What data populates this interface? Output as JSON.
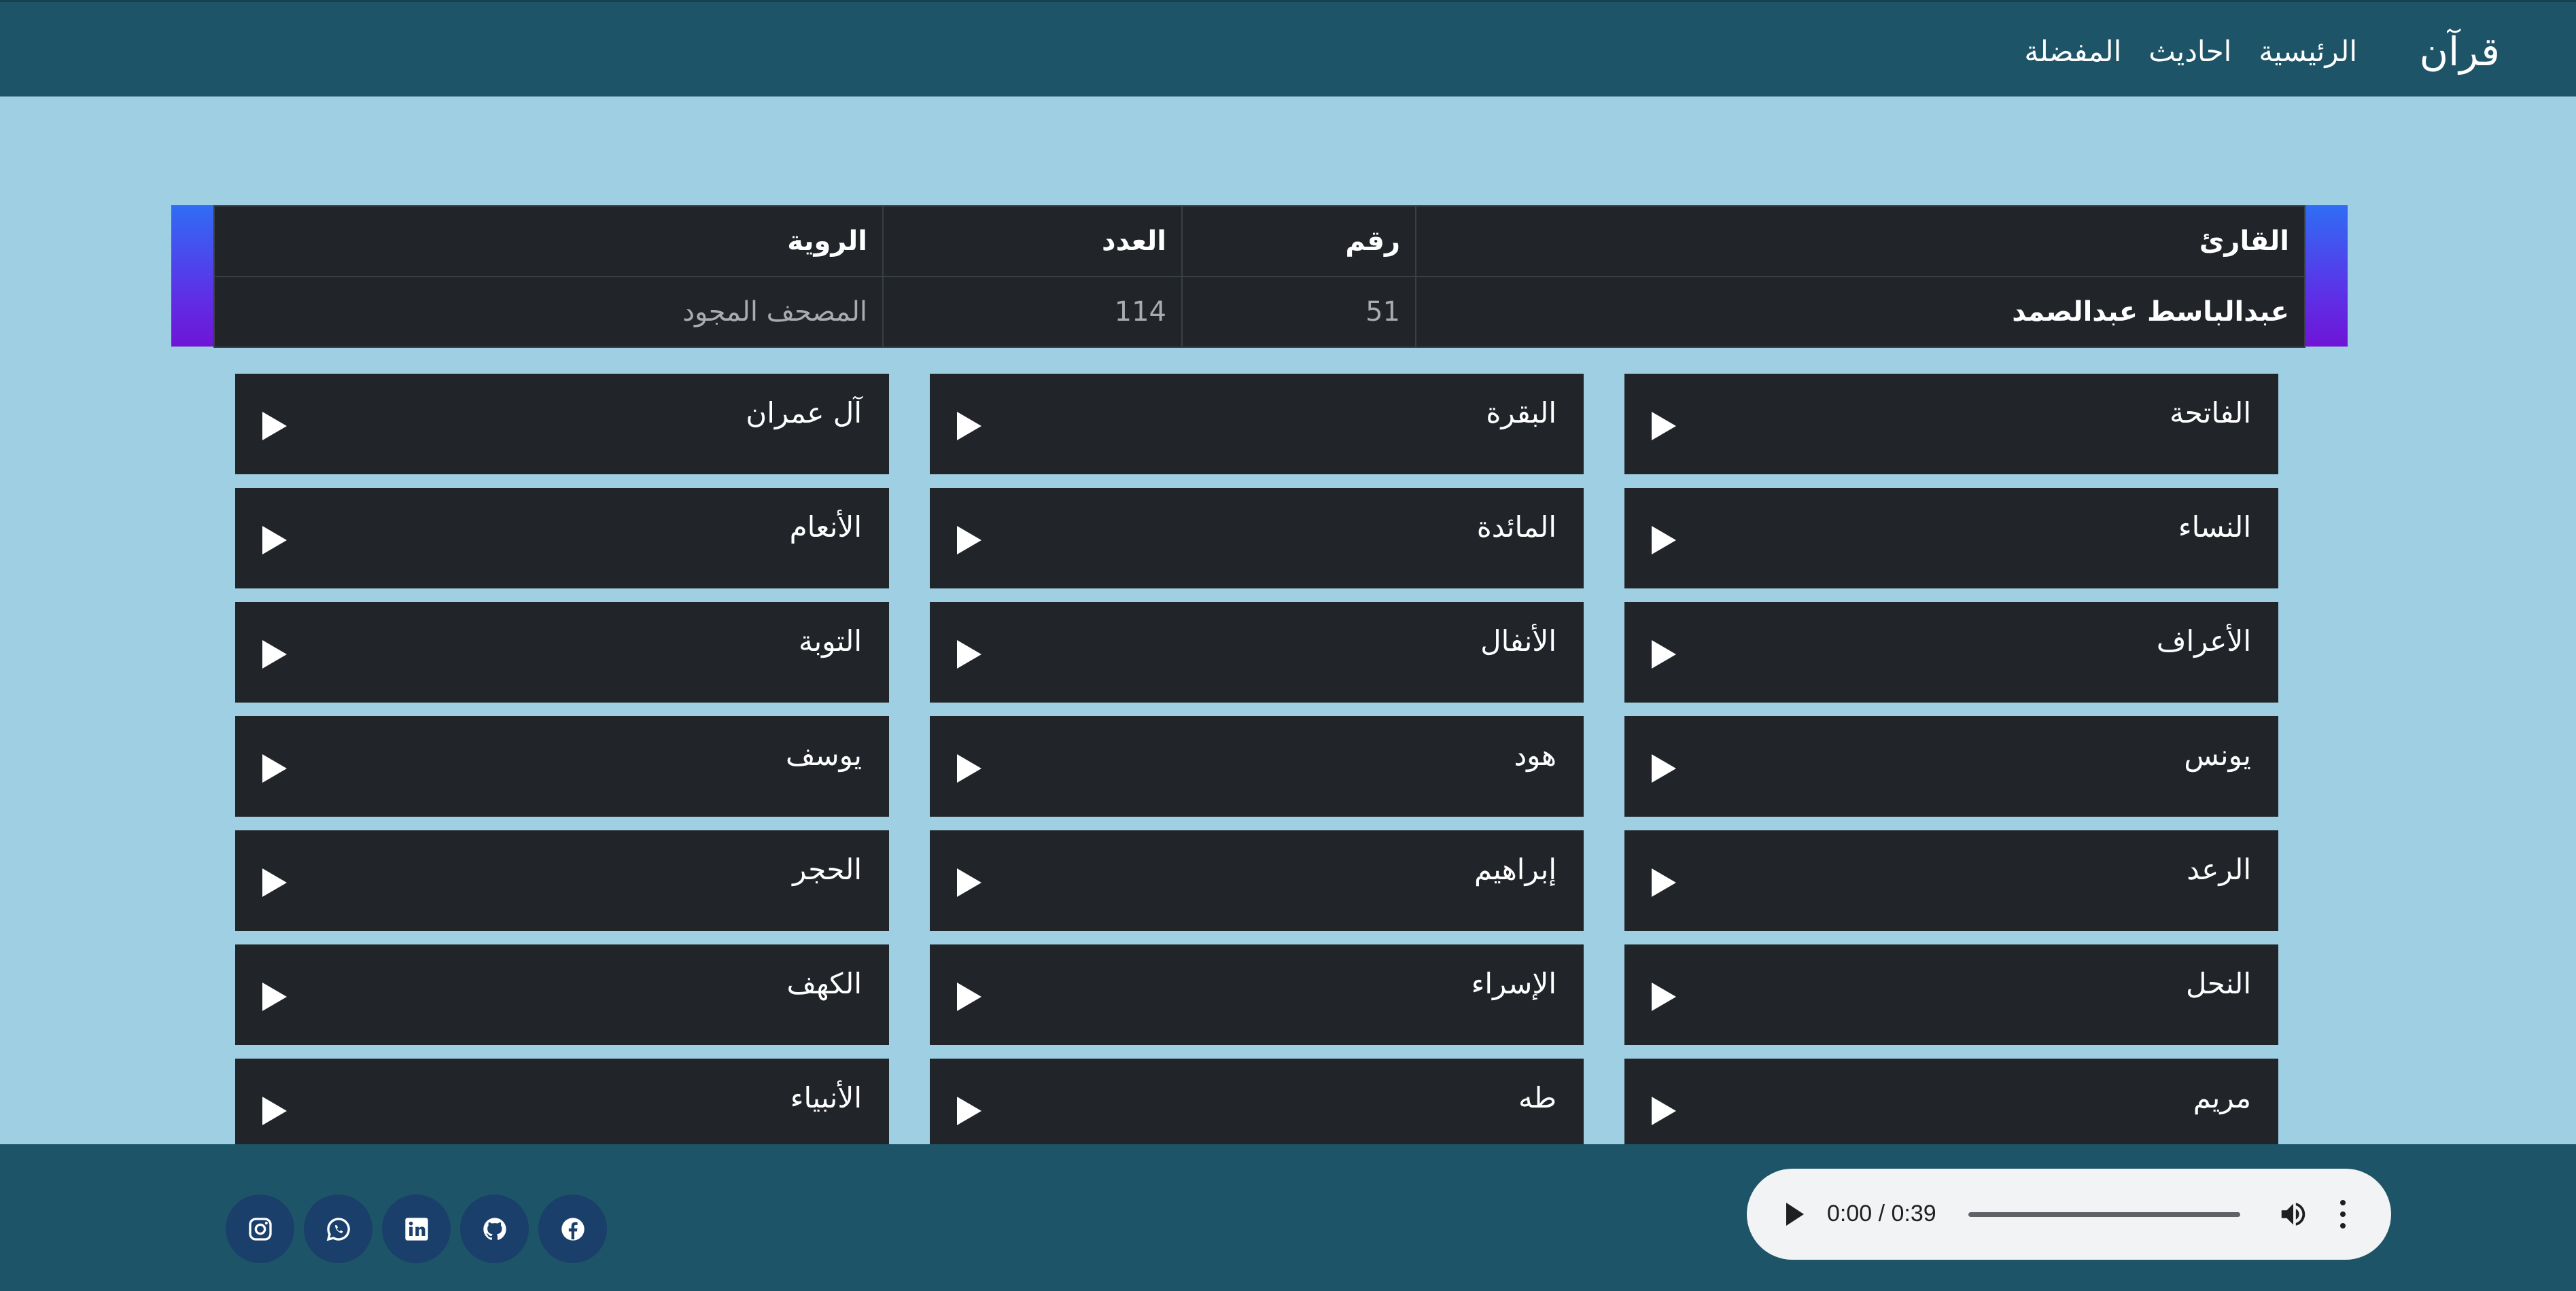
{
  "nav": {
    "brand": "قرآن",
    "links": [
      "الرئيسية",
      "احاديث",
      "المفضلة"
    ]
  },
  "info_table": {
    "headers": {
      "reader": "القارئ",
      "number": "رقم",
      "count": "العدد",
      "narration": "الروية"
    },
    "row": {
      "reader": "عبدالباسط عبدالصمد",
      "number": "51",
      "count": "114",
      "narration": "المصحف المجود"
    },
    "accent_gradient": [
      "#2f6df4",
      "#6f15d6"
    ]
  },
  "surahs": [
    "الفاتحة",
    "البقرة",
    "آل عمران",
    "النساء",
    "المائدة",
    "الأنعام",
    "الأعراف",
    "الأنفال",
    "التوبة",
    "يونس",
    "هود",
    "يوسف",
    "الرعد",
    "إبراهيم",
    "الحجر",
    "النحل",
    "الإسراء",
    "الكهف",
    "مريم",
    "طه",
    "الأنبياء"
  ],
  "player": {
    "time": "0:00 / 0:39",
    "progress": 0
  },
  "socials": [
    "instagram-icon",
    "whatsapp-icon",
    "linkedin-icon",
    "github-icon",
    "facebook-icon"
  ],
  "colors": {
    "background": "#9ecfe2",
    "navbar": "#1d5468",
    "card": "#212529",
    "social": "#1a3f6a"
  }
}
